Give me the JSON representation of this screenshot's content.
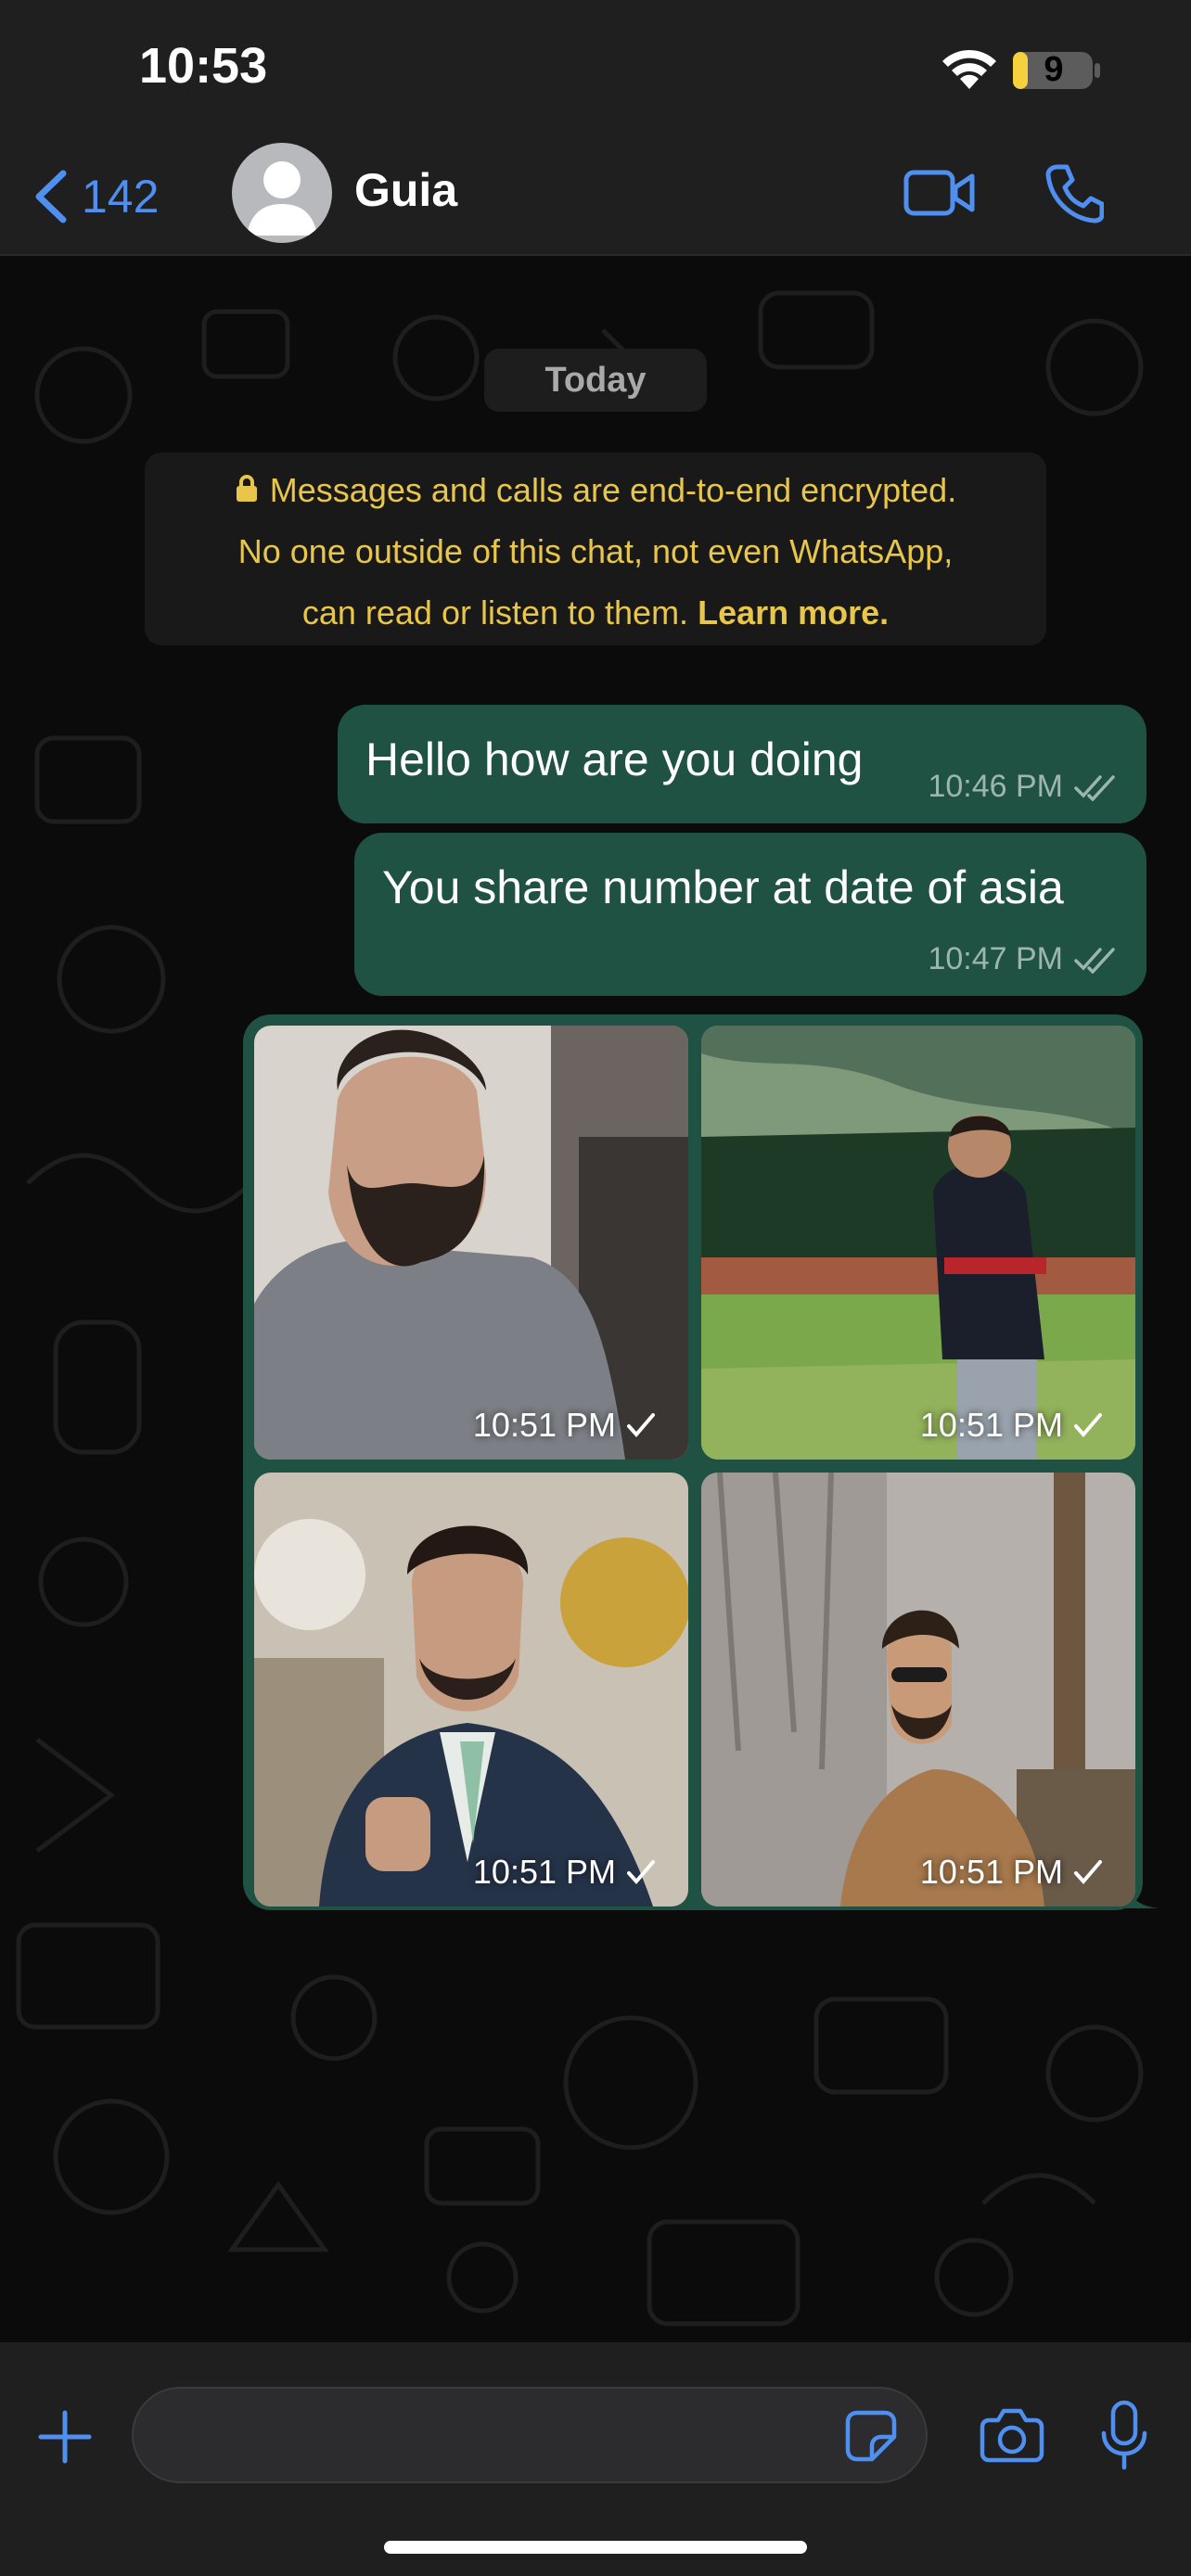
{
  "status_bar": {
    "time": "10:53",
    "battery_level": "9",
    "battery_percent": 9,
    "wifi_icon": "wifi-icon",
    "battery_icon": "battery-icon"
  },
  "header": {
    "back_count": "142",
    "back_icon": "chevron-left-icon",
    "contact_name": "Guia",
    "avatar_icon": "person-silhouette-icon",
    "video_icon": "video-camera-icon",
    "call_icon": "phone-icon",
    "accent_color": "#4f8ff0"
  },
  "chat": {
    "date_label": "Today",
    "encryption": {
      "line1": "Messages and calls are end-to-end encrypted.",
      "line2": "No one outside of this chat, not even WhatsApp,",
      "line3": "can read or listen to them.",
      "learn_more": "Learn more.",
      "lock_icon": "lock-icon",
      "color": "#e8c64c"
    },
    "messages": [
      {
        "text": "Hello how are you doing",
        "time": "10:46 PM",
        "status_icon": "double-check-icon"
      },
      {
        "text": "You share number at date of asia",
        "time": "10:47 PM",
        "status_icon": "double-check-icon"
      }
    ],
    "album": {
      "photos": [
        {
          "time": "10:51 PM",
          "status_icon": "check-icon",
          "description": "selfie-man-gray-sweater"
        },
        {
          "time": "10:51 PM",
          "status_icon": "check-icon",
          "description": "man-in-mountain-meadow"
        },
        {
          "time": "10:51 PM",
          "status_icon": "check-icon",
          "description": "man-in-suit"
        },
        {
          "time": "10:51 PM",
          "status_icon": "check-icon",
          "description": "man-in-leather-jacket"
        }
      ]
    },
    "bubble_color": "#1f5243"
  },
  "input_bar": {
    "placeholder": "",
    "attach_icon": "plus-icon",
    "sticker_icon": "sticker-icon",
    "camera_icon": "camera-icon",
    "mic_icon": "microphone-icon"
  }
}
